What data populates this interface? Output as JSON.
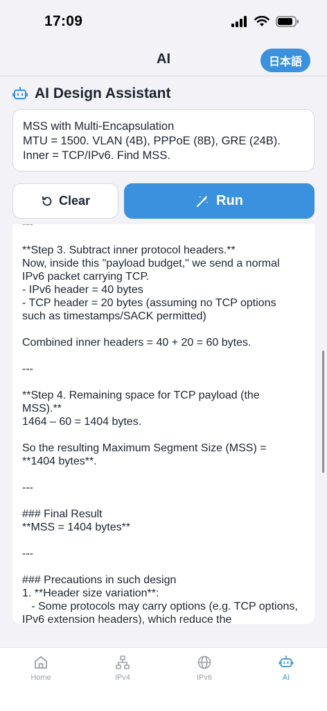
{
  "status": {
    "time": "17:09"
  },
  "nav": {
    "title": "AI",
    "language_button": "日本語"
  },
  "assistant": {
    "title": "AI Design Assistant",
    "prompt_lines": [
      "MSS with Multi-Encapsulation",
      "MTU = 1500. VLAN (4B), PPPoE (8B), GRE (24B).",
      "Inner = TCP/IPv6. Find MSS."
    ],
    "clear_label": "Clear",
    "run_label": "Run"
  },
  "output_text": "---\n\n**Step 3. Subtract inner protocol headers.**\nNow, inside this \"payload budget,\" we send a normal IPv6 packet carrying TCP.\n- IPv6 header = 40 bytes\n- TCP header = 20 bytes (assuming no TCP options such as timestamps/SACK permitted)\n\nCombined inner headers = 40 + 20 = 60 bytes.\n\n---\n\n**Step 4. Remaining space for TCP payload (the MSS).**\n1464 – 60 = 1404 bytes.\n\nSo the resulting Maximum Segment Size (MSS) = **1404 bytes**.\n\n---\n\n### Final Result\n**MSS = 1404 bytes**\n\n---\n\n### Precautions in such design\n1. **Header size variation**:\n   - Some protocols may carry options (e.g. TCP options, IPv6 extension headers), which reduce the",
  "tabs": [
    {
      "label": "Home",
      "icon": "home-icon"
    },
    {
      "label": "IPv4",
      "icon": "network-icon"
    },
    {
      "label": "IPv6",
      "icon": "globe-icon"
    },
    {
      "label": "AI",
      "icon": "robot-icon",
      "active": true
    }
  ],
  "colors": {
    "accent": "#3a91dd",
    "background": "#f2f2f7",
    "text": "#1c2430",
    "inactive": "#9aa0a8"
  }
}
